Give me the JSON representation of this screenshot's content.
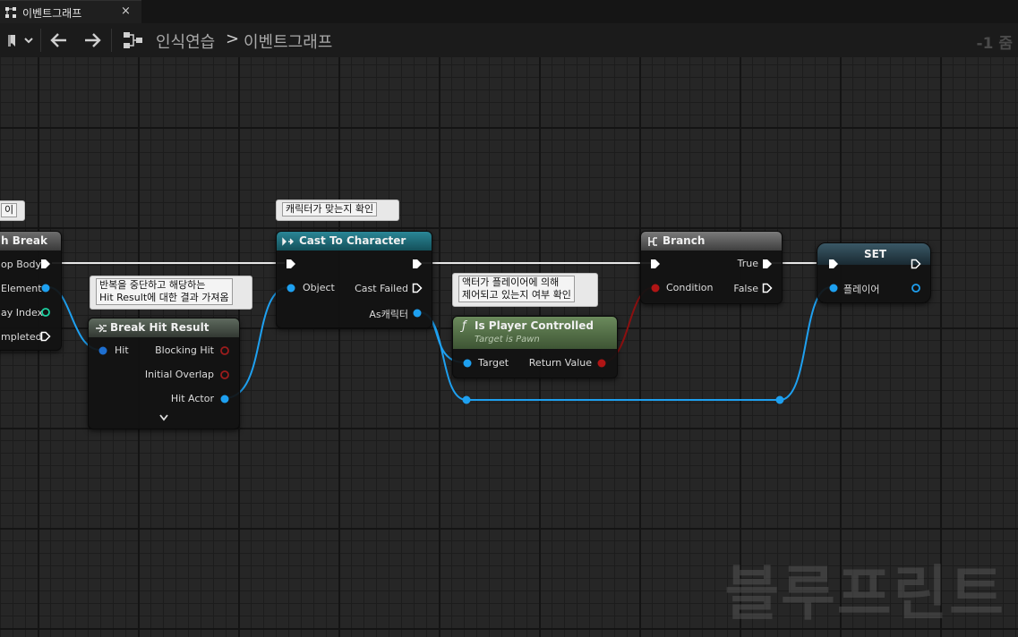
{
  "tab": {
    "title": "이벤트그래프",
    "close": "×"
  },
  "toolbar": {
    "zoom": "-1 줌"
  },
  "breadcrumb": {
    "root": "인식연습",
    "separator": ">",
    "current": "이벤트그래프"
  },
  "watermark": "블루프린트",
  "comments": {
    "left_partial": "이",
    "cast": "캐릭터가 맞는지 확인",
    "break_hit_line1": "반복을 중단하고 해당하는",
    "break_hit_line2": "Hit Result에 대한 결과 가져옴",
    "is_player_line1": "액터가 플레이어에 의해",
    "is_player_line2": "제어되고 있는지 여부 확인"
  },
  "nodes": {
    "loop": {
      "title": "h Break",
      "pins": [
        "op Body",
        "Element",
        "ay Index",
        "mpleted"
      ]
    },
    "break_hit": {
      "title": "Break Hit Result",
      "hit": "Hit",
      "blocking_hit": "Blocking Hit",
      "initial_overlap": "Initial Overlap",
      "hit_actor": "Hit Actor"
    },
    "cast": {
      "title": "Cast To Character",
      "object": "Object",
      "cast_failed": "Cast Failed",
      "as_character": "As캐릭터"
    },
    "is_player": {
      "title": "Is Player Controlled",
      "subtitle": "Target is Pawn",
      "target": "Target",
      "return_value": "Return Value"
    },
    "branch": {
      "title": "Branch",
      "condition": "Condition",
      "true": "True",
      "false": "False"
    },
    "set": {
      "title": "SET",
      "player": "플레이어"
    }
  },
  "colors": {
    "exec": "#ffffff",
    "object": "#1ea0f0",
    "bool": "#8b0000",
    "int": "#1dd1a1",
    "cast_header": "#1c6a78",
    "pure_header": "#4f6b43"
  }
}
